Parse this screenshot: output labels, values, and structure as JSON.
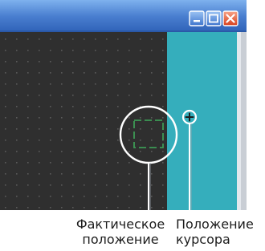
{
  "window": {
    "buttons": [
      {
        "name": "minimize",
        "icon": "minimize-icon"
      },
      {
        "name": "maximize",
        "icon": "maximize-icon"
      },
      {
        "name": "close",
        "icon": "close-icon"
      }
    ]
  },
  "callouts": {
    "actual_position": {
      "line1": "Фактическое",
      "line2": "положение"
    },
    "cursor_position": {
      "line1": "Положение",
      "line2": "курсора"
    }
  },
  "colors": {
    "titlebar": "#4a7fd0",
    "canvas": "#2f2f2f",
    "side_panel": "#35aebc",
    "close_button": "#e8502e",
    "window_button": "#5b8fd8",
    "marker_green": "#3d9a55",
    "callout_line": "#ffffff"
  }
}
